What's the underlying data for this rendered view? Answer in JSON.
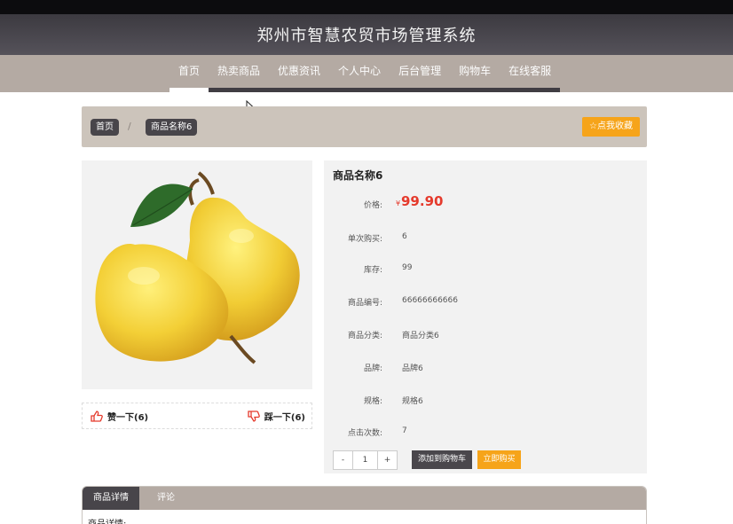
{
  "header": {
    "title": "郑州市智慧农贸市场管理系统"
  },
  "nav": {
    "items": [
      {
        "label": "首页",
        "active": true
      },
      {
        "label": "热卖商品",
        "active": false
      },
      {
        "label": "优惠资讯",
        "active": false
      },
      {
        "label": "个人中心",
        "active": false
      },
      {
        "label": "后台管理",
        "active": false
      },
      {
        "label": "购物车",
        "active": false
      },
      {
        "label": "在线客服",
        "active": false
      }
    ]
  },
  "breadcrumb": {
    "home": "首页",
    "separator": "/",
    "current": "商品名称6"
  },
  "favorite_button": {
    "label": "点我收藏",
    "icon": "star-icon"
  },
  "product": {
    "image_icon": "pear-image",
    "name": "商品名称6",
    "price_currency": "¥",
    "price": "99.90",
    "fields": [
      {
        "label": "单次购买:",
        "value": "6"
      },
      {
        "label": "库存:",
        "value": "99"
      },
      {
        "label": "商品编号:",
        "value": "66666666666"
      },
      {
        "label": "商品分类:",
        "value": "商品分类6"
      },
      {
        "label": "品牌:",
        "value": "品牌6"
      },
      {
        "label": "规格:",
        "value": "规格6"
      },
      {
        "label": "点击次数:",
        "value": "7"
      }
    ],
    "price_label": "价格:"
  },
  "votes": {
    "like_label": "赞一下(6)",
    "dislike_label": "踩一下(6)"
  },
  "quantity": {
    "minus": "-",
    "value": "1",
    "plus": "+"
  },
  "actions": {
    "add_to_cart": "添加到购物车",
    "buy_now": "立即购买"
  },
  "tabs": {
    "items": [
      "商品详情",
      "评论"
    ],
    "body_label": "商品详情:"
  },
  "colors": {
    "accent": "#f6a41a",
    "dark": "#48454a",
    "nav_bg": "#b4aaa3",
    "price": "#e53a2c"
  }
}
